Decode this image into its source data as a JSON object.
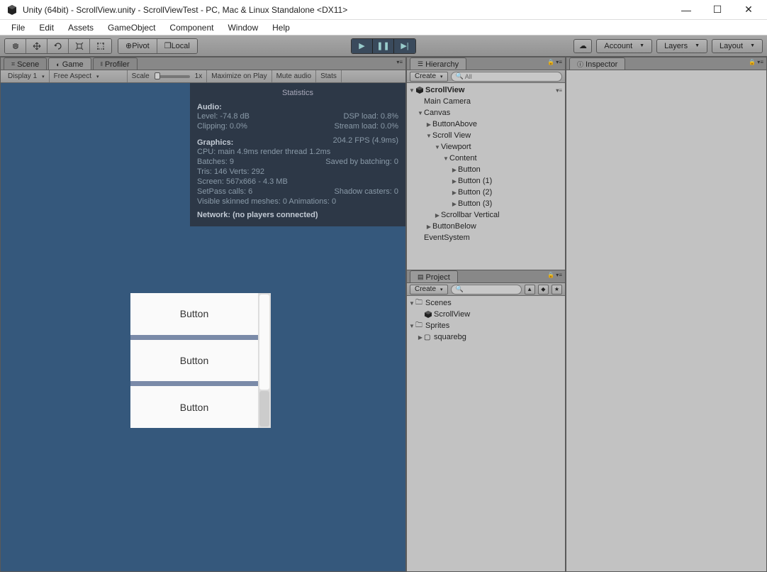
{
  "window": {
    "title": "Unity (64bit) - ScrollView.unity - ScrollViewTest - PC, Mac & Linux Standalone <DX11>"
  },
  "menu": [
    "File",
    "Edit",
    "Assets",
    "GameObject",
    "Component",
    "Window",
    "Help"
  ],
  "toolbar": {
    "pivot": "Pivot",
    "local": "Local",
    "account": "Account",
    "layers": "Layers",
    "layout": "Layout"
  },
  "tabs": {
    "scene": "Scene",
    "game": "Game",
    "profiler": "Profiler",
    "hierarchy": "Hierarchy",
    "project": "Project",
    "inspector": "Inspector"
  },
  "gamebar": {
    "display": "Display 1",
    "aspect": "Free Aspect",
    "scale_label": "Scale",
    "scale_value": "1x",
    "max_on_play": "Maximize on Play",
    "mute_audio": "Mute audio",
    "stats": "Stats"
  },
  "stats": {
    "title": "Statistics",
    "audio": "Audio:",
    "level": "Level: -74.8 dB",
    "dsp": "DSP load: 0.8%",
    "clipping": "Clipping: 0.0%",
    "stream": "Stream load: 0.0%",
    "graphics": "Graphics:",
    "fps": "204.2 FPS (4.9ms)",
    "cpu": "CPU: main 4.9ms  render thread 1.2ms",
    "batches": "Batches: 9",
    "saved": "Saved by batching: 0",
    "tris": "Tris: 146 Verts: 292",
    "screen": "Screen: 567x666 - 4.3 MB",
    "setpass": "SetPass calls: 6",
    "shadow": "Shadow casters: 0",
    "skinned": "Visible skinned meshes: 0  Animations: 0",
    "network": "Network: (no players connected)"
  },
  "game_buttons": [
    "Button",
    "Button",
    "Button"
  ],
  "hierarchy": {
    "create": "Create",
    "search_label": "All",
    "scene": "ScrollView",
    "items": [
      {
        "label": "Main Camera",
        "indent": 1,
        "arrow": ""
      },
      {
        "label": "Canvas",
        "indent": 1,
        "arrow": "▼"
      },
      {
        "label": "ButtonAbove",
        "indent": 2,
        "arrow": "▶"
      },
      {
        "label": "Scroll View",
        "indent": 2,
        "arrow": "▼"
      },
      {
        "label": "Viewport",
        "indent": 3,
        "arrow": "▼"
      },
      {
        "label": "Content",
        "indent": 4,
        "arrow": "▼"
      },
      {
        "label": "Button",
        "indent": 5,
        "arrow": "▶"
      },
      {
        "label": "Button (1)",
        "indent": 5,
        "arrow": "▶"
      },
      {
        "label": "Button (2)",
        "indent": 5,
        "arrow": "▶"
      },
      {
        "label": "Button (3)",
        "indent": 5,
        "arrow": "▶"
      },
      {
        "label": "Scrollbar Vertical",
        "indent": 3,
        "arrow": "▶"
      },
      {
        "label": "ButtonBelow",
        "indent": 2,
        "arrow": "▶"
      },
      {
        "label": "EventSystem",
        "indent": 1,
        "arrow": ""
      }
    ]
  },
  "project": {
    "create": "Create",
    "items": [
      {
        "label": "Scenes",
        "indent": 0,
        "arrow": "▼",
        "icon": "folder"
      },
      {
        "label": "ScrollView",
        "indent": 1,
        "arrow": "",
        "icon": "unity"
      },
      {
        "label": "Sprites",
        "indent": 0,
        "arrow": "▼",
        "icon": "folder"
      },
      {
        "label": "squarebg",
        "indent": 1,
        "arrow": "▶",
        "icon": "square"
      }
    ]
  }
}
